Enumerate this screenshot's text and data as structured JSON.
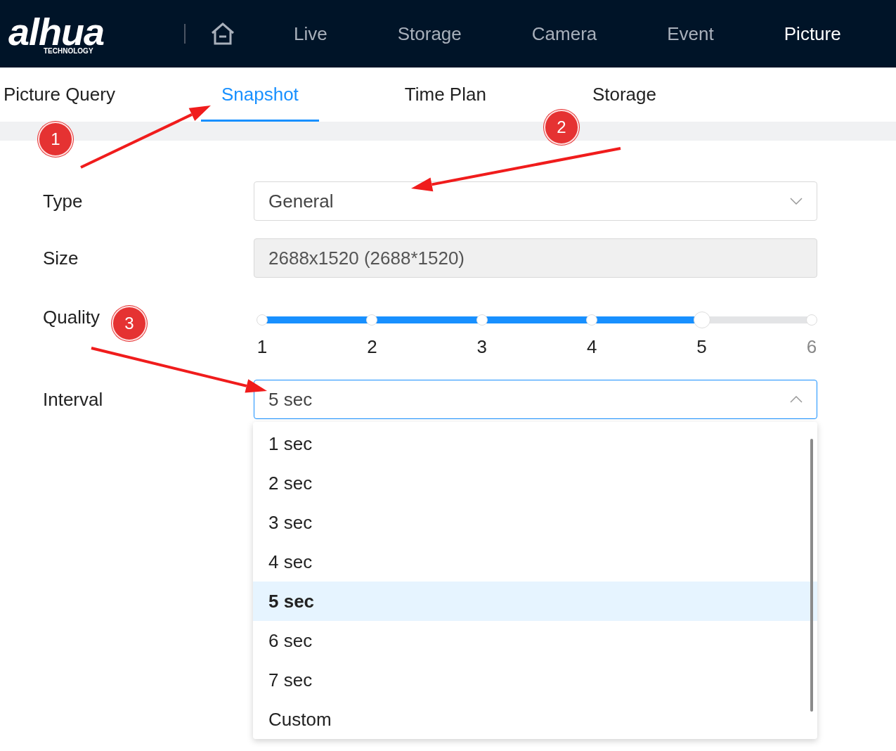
{
  "logo": {
    "brand": "alhua",
    "tagline": "TECHNOLOGY"
  },
  "nav": [
    {
      "label": "Live",
      "selected": false
    },
    {
      "label": "Storage",
      "selected": false
    },
    {
      "label": "Camera",
      "selected": false
    },
    {
      "label": "Event",
      "selected": false
    },
    {
      "label": "Picture",
      "selected": true
    }
  ],
  "tabs": [
    {
      "label": "Picture Query",
      "selected": false
    },
    {
      "label": "Snapshot",
      "selected": true
    },
    {
      "label": "Time Plan",
      "selected": false
    },
    {
      "label": "Storage",
      "selected": false
    }
  ],
  "form": {
    "type": {
      "label": "Type",
      "value": "General"
    },
    "size": {
      "label": "Size",
      "value": "2688x1520 (2688*1520)",
      "disabled": true
    },
    "quality": {
      "label": "Quality",
      "level": 0.8,
      "ticks": [
        "1",
        "2",
        "3",
        "4",
        "5",
        "6"
      ]
    },
    "interval": {
      "label": "Interval",
      "value": "5 sec",
      "expanded": true,
      "options": [
        {
          "label": "1 sec",
          "selected": false
        },
        {
          "label": "2 sec",
          "selected": false
        },
        {
          "label": "3 sec",
          "selected": false
        },
        {
          "label": "4 sec",
          "selected": false
        },
        {
          "label": "5 sec",
          "selected": true
        },
        {
          "label": "6 sec",
          "selected": false
        },
        {
          "label": "7 sec",
          "selected": false
        },
        {
          "label": "Custom",
          "selected": false
        }
      ]
    }
  },
  "annotations": [
    {
      "label": "1"
    },
    {
      "label": "2"
    },
    {
      "label": "3"
    }
  ]
}
